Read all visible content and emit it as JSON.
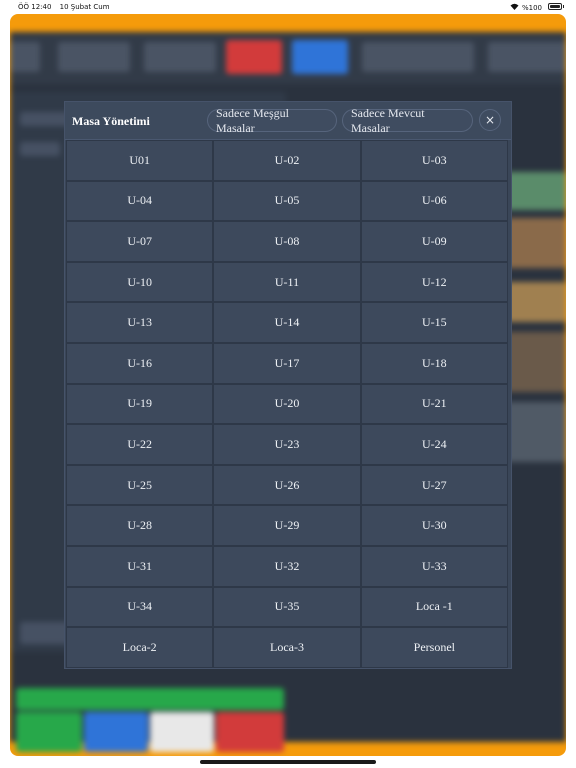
{
  "status_bar": {
    "time": "ÖÖ 12:40",
    "date": "10 Şubat Cum",
    "battery": "%100"
  },
  "modal": {
    "title": "Masa Yönetimi",
    "filter_busy": "Sadece Meşgul Masalar",
    "filter_available": "Sadece Mevcut Masalar",
    "close_symbol": "×",
    "tables": [
      "U01",
      "U-02",
      "U-03",
      "U-04",
      "U-05",
      "U-06",
      "U-07",
      "U-08",
      "U-09",
      "U-10",
      "U-11",
      "U-12",
      "U-13",
      "U-14",
      "U-15",
      "U-16",
      "U-17",
      "U-18",
      "U-19",
      "U-20",
      "U-21",
      "U-22",
      "U-23",
      "U-24",
      "U-25",
      "U-26",
      "U-27",
      "U-28",
      "U-29",
      "U-30",
      "U-31",
      "U-32",
      "U-33",
      "U-34",
      "U-35",
      "Loca -1",
      "Loca-2",
      "Loca-3",
      "Personel"
    ]
  },
  "colors": {
    "frame": "#f59b0b",
    "modal_bg": "#3a4658",
    "cell_bg": "#3d495c"
  }
}
